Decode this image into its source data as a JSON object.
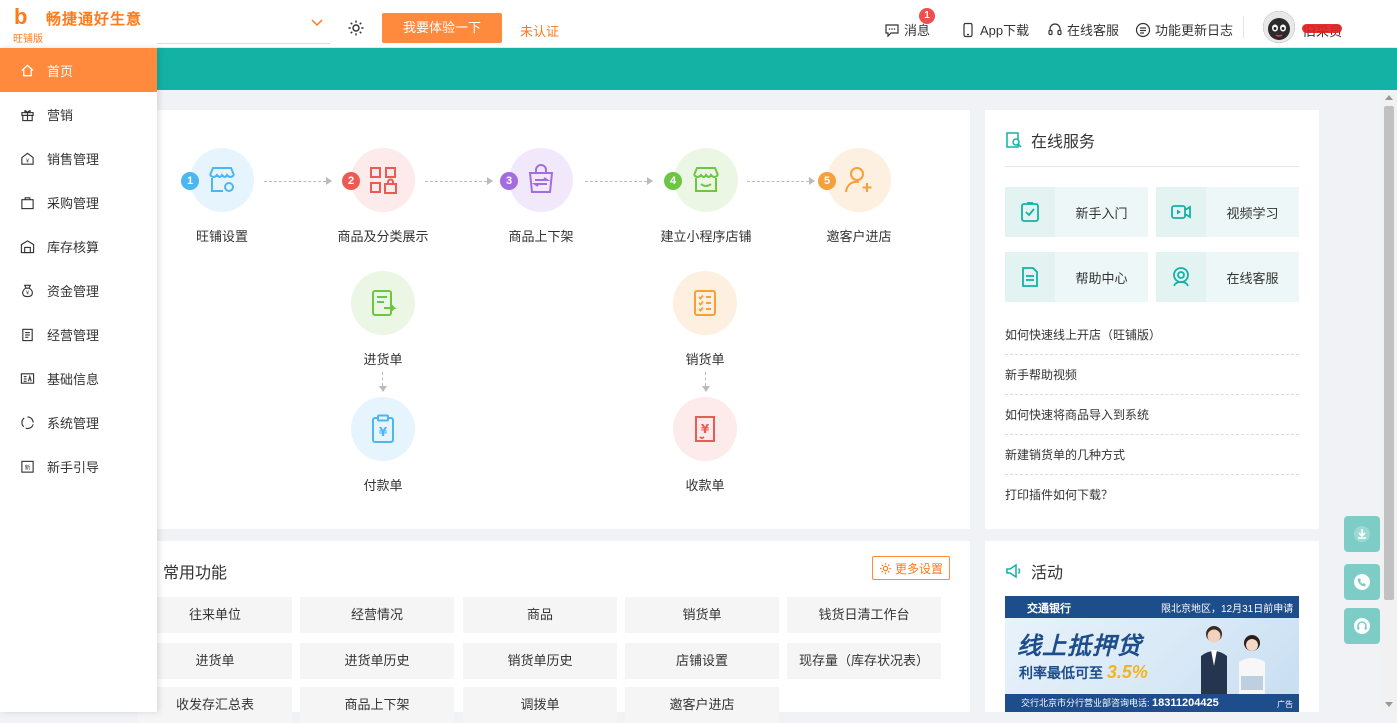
{
  "app": {
    "logo_text": "畅捷通好生意",
    "logo_version": "旺铺版",
    "logo_glyph": "b"
  },
  "header": {
    "try_button": "我要体验一下",
    "cert_status": "未认证",
    "messages_label": "消息",
    "messages_badge": "1",
    "app_download": "App下载",
    "online_service": "在线客服",
    "changelog": "功能更新日志",
    "username": "旧采员"
  },
  "sidebar": {
    "items": [
      {
        "label": "首页",
        "icon": "home-icon"
      },
      {
        "label": "营销",
        "icon": "gift-icon"
      },
      {
        "label": "销售管理",
        "icon": "sales-icon"
      },
      {
        "label": "采购管理",
        "icon": "purchase-icon"
      },
      {
        "label": "库存核算",
        "icon": "warehouse-icon"
      },
      {
        "label": "资金管理",
        "icon": "money-bag-icon"
      },
      {
        "label": "经营管理",
        "icon": "clipboard-icon"
      },
      {
        "label": "基础信息",
        "icon": "info-card-icon"
      },
      {
        "label": "系统管理",
        "icon": "system-icon"
      },
      {
        "label": "新手引导",
        "icon": "guide-icon"
      }
    ]
  },
  "flow": {
    "steps": [
      {
        "num": "1",
        "label": "旺铺设置",
        "color": "#4cb6f0",
        "bg": "#e6f5fd"
      },
      {
        "num": "2",
        "label": "商品及分类展示",
        "color": "#ec5b53",
        "bg": "#fdeaea"
      },
      {
        "num": "3",
        "label": "商品上下架",
        "color": "#a36ce0",
        "bg": "#f1e9fb"
      },
      {
        "num": "4",
        "label": "建立小程序店铺",
        "color": "#6cc644",
        "bg": "#ebf7e4"
      },
      {
        "num": "5",
        "label": "邀客户进店",
        "color": "#f5a03a",
        "bg": "#fdf0e1"
      }
    ],
    "purchase_order": "进货单",
    "payment_order": "付款单",
    "sales_order": "销货单",
    "receipt_order": "收款单"
  },
  "service": {
    "title": "在线服务",
    "tiles": [
      {
        "label": "新手入门",
        "icon": "checklist-icon"
      },
      {
        "label": "视频学习",
        "icon": "video-icon"
      },
      {
        "label": "帮助中心",
        "icon": "document-icon"
      },
      {
        "label": "在线客服",
        "icon": "headset-icon"
      }
    ],
    "faqs": [
      "如何快速线上开店（旺铺版）",
      "新手帮助视频",
      "如何快速将商品导入到系统",
      "新建销货单的几种方式",
      "打印插件如何下载？"
    ]
  },
  "common": {
    "title": "常用功能",
    "more_settings": "更多设置",
    "rows": [
      [
        "往来单位",
        "经营情况",
        "商品",
        "销货单",
        "钱货日清工作台"
      ],
      [
        "进货单",
        "进货单历史",
        "销货单历史",
        "店铺设置",
        "现存量（库存状况表）"
      ],
      [
        "收发存汇总表",
        "商品上下架",
        "调拨单",
        "邀客户进店"
      ]
    ]
  },
  "activity": {
    "title": "活动",
    "banner": {
      "bank": "交通银行",
      "region": "限北京地区，12月31日前申请",
      "headline": "线上抵押贷",
      "rate_prefix": "利率最低可至",
      "rate": "3.5%",
      "foot": "交行北京市分行营业部咨询电话:",
      "phone": "18311204425",
      "ad": "广告"
    }
  },
  "colors": {
    "accent": "#ff8a3d",
    "teal": "#13b2a5"
  }
}
